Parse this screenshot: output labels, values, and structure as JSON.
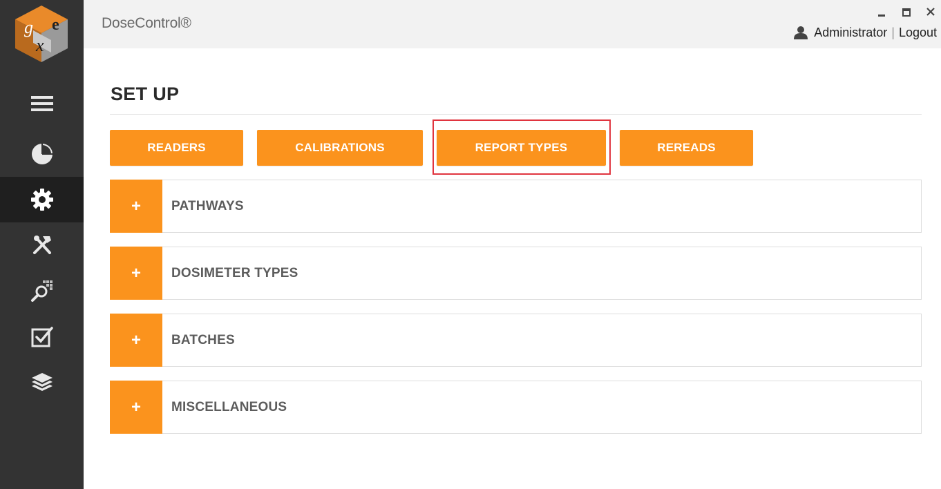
{
  "app": {
    "title": "DoseControl®",
    "logo_alt": "GEX logo"
  },
  "user": {
    "name": "Administrator",
    "separator": "|",
    "logout_label": "Logout"
  },
  "window_controls": {
    "minimize": "minimize-icon",
    "maximize": "maximize-icon",
    "close": "close-icon"
  },
  "sidebar": {
    "items": [
      {
        "name": "menu",
        "icon": "hamburger-icon",
        "active": false
      },
      {
        "name": "dashboard",
        "icon": "pie-chart-icon",
        "active": false
      },
      {
        "name": "setup",
        "icon": "gear-icon",
        "active": true
      },
      {
        "name": "tools",
        "icon": "tools-icon",
        "active": false
      },
      {
        "name": "search",
        "icon": "search-grid-icon",
        "active": false
      },
      {
        "name": "tasks",
        "icon": "checkbox-icon",
        "active": false
      },
      {
        "name": "layers",
        "icon": "layers-icon",
        "active": false
      }
    ]
  },
  "page": {
    "title": "SET UP"
  },
  "tabs": [
    {
      "label": "READERS"
    },
    {
      "label": "CALIBRATIONS"
    },
    {
      "label": "REPORT TYPES",
      "highlighted": true
    },
    {
      "label": "REREADS"
    }
  ],
  "sections": [
    {
      "toggle": "+",
      "label": "PATHWAYS"
    },
    {
      "toggle": "+",
      "label": "DOSIMETER TYPES"
    },
    {
      "toggle": "+",
      "label": "BATCHES"
    },
    {
      "toggle": "+",
      "label": "MISCELLANEOUS"
    }
  ],
  "colors": {
    "accent": "#fb931d",
    "sidebar": "#333333",
    "sidebar_active": "#1f1f1f",
    "header": "#f2f2f2",
    "highlight": "#e0343f"
  }
}
